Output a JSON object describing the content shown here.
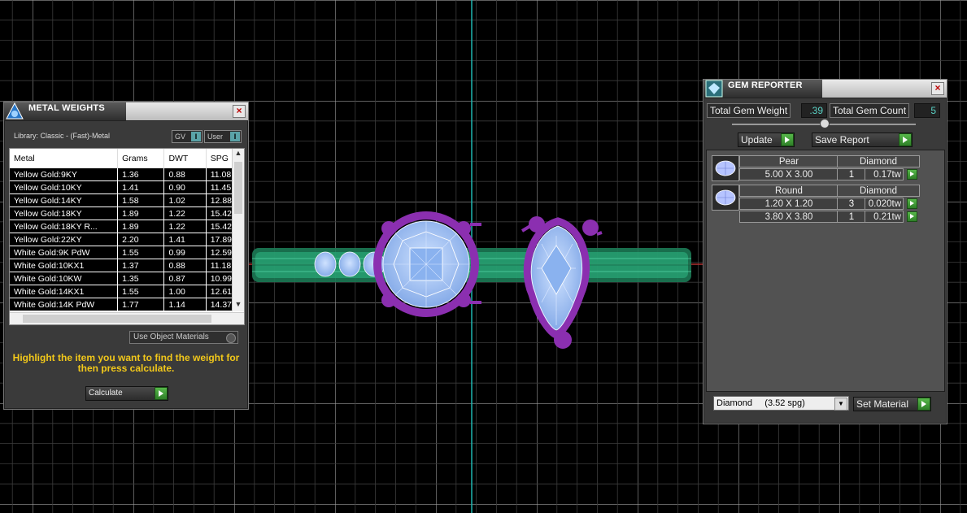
{
  "metal_weights": {
    "title": "METAL WEIGHTS",
    "library_label": "Library: Classic - (Fast)-Metal",
    "toggle_gv": "GV",
    "toggle_user": "User",
    "columns": [
      "Metal",
      "Grams",
      "DWT",
      "SPG"
    ],
    "rows": [
      [
        "Yellow Gold:9KY",
        "1.36",
        "0.88",
        "11.08"
      ],
      [
        "Yellow Gold:10KY",
        "1.41",
        "0.90",
        "11.45"
      ],
      [
        "Yellow Gold:14KY",
        "1.58",
        "1.02",
        "12.88"
      ],
      [
        "Yellow Gold:18KY",
        "1.89",
        "1.22",
        "15.42"
      ],
      [
        "Yellow Gold:18KY R...",
        "1.89",
        "1.22",
        "15.42"
      ],
      [
        "Yellow Gold:22KY",
        "2.20",
        "1.41",
        "17.89"
      ],
      [
        "White Gold:9K PdW",
        "1.55",
        "0.99",
        "12.59"
      ],
      [
        "White Gold:10KX1",
        "1.37",
        "0.88",
        "11.18"
      ],
      [
        "White Gold:10KW",
        "1.35",
        "0.87",
        "10.99"
      ],
      [
        "White Gold:14KX1",
        "1.55",
        "1.00",
        "12.61"
      ],
      [
        "White Gold:14K PdW",
        "1.77",
        "1.14",
        "14.37"
      ]
    ],
    "use_object_materials": "Use Object Materials",
    "instructions": "Highlight the item you want to find the weight for then press calculate.",
    "calculate_label": "Calculate"
  },
  "gem_reporter": {
    "title": "GEM REPORTER",
    "total_weight_label": "Total Gem Weight",
    "total_weight_value": ".39",
    "total_count_label": "Total Gem Count",
    "total_count_value": "5",
    "update_label": "Update",
    "save_report_label": "Save Report",
    "groups": [
      {
        "shape": "Pear",
        "material": "Diamond",
        "rows": [
          [
            "5.00 X 3.00",
            "1",
            "0.17tw"
          ]
        ]
      },
      {
        "shape": "Round",
        "material": "Diamond",
        "rows": [
          [
            "1.20 X 1.20",
            "3",
            "0.020tw"
          ],
          [
            "3.80 X 3.80",
            "1",
            "0.21tw"
          ]
        ]
      }
    ],
    "material_select": "Diamond     (3.52 spg)",
    "set_material_label": "Set Material"
  },
  "icons": [
    "metal-weights-app-icon",
    "gem-reporter-app-icon",
    "close-icon",
    "green-play-icon",
    "gem-icon",
    "dropdown-arrow-icon"
  ]
}
